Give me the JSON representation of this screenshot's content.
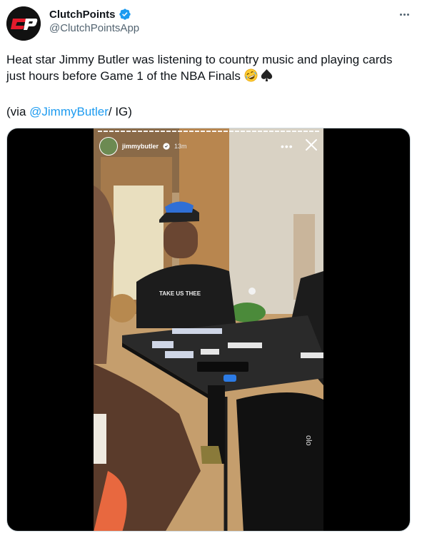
{
  "author": {
    "display_name": "ClutchPoints",
    "handle": "@ClutchPointsApp",
    "avatar_text": "CP",
    "avatar_bg": "#111111",
    "avatar_accent": "#e41b2c",
    "verified": true,
    "verified_color": "#1d9bf0"
  },
  "tweet": {
    "line1": "Heat star Jimmy Butler was listening to country music and playing cards",
    "line2": "just hours before Game 1 of the NBA Finals",
    "emojis": [
      "rolling-on-floor-laughing-emoji",
      "spade-suit-emoji"
    ],
    "via_prefix": "(via ",
    "via_mention": "@JimmyButler",
    "via_suffix": "/ IG)",
    "link_color": "#1d9bf0"
  },
  "story": {
    "username": "jimmybutler",
    "time": "13m",
    "shirt_text": "TAKE US THEE",
    "shorts_text": "olo"
  },
  "icons": {
    "more": "more-horizontal-icon",
    "close": "close-icon",
    "verified": "verified-badge-icon"
  }
}
